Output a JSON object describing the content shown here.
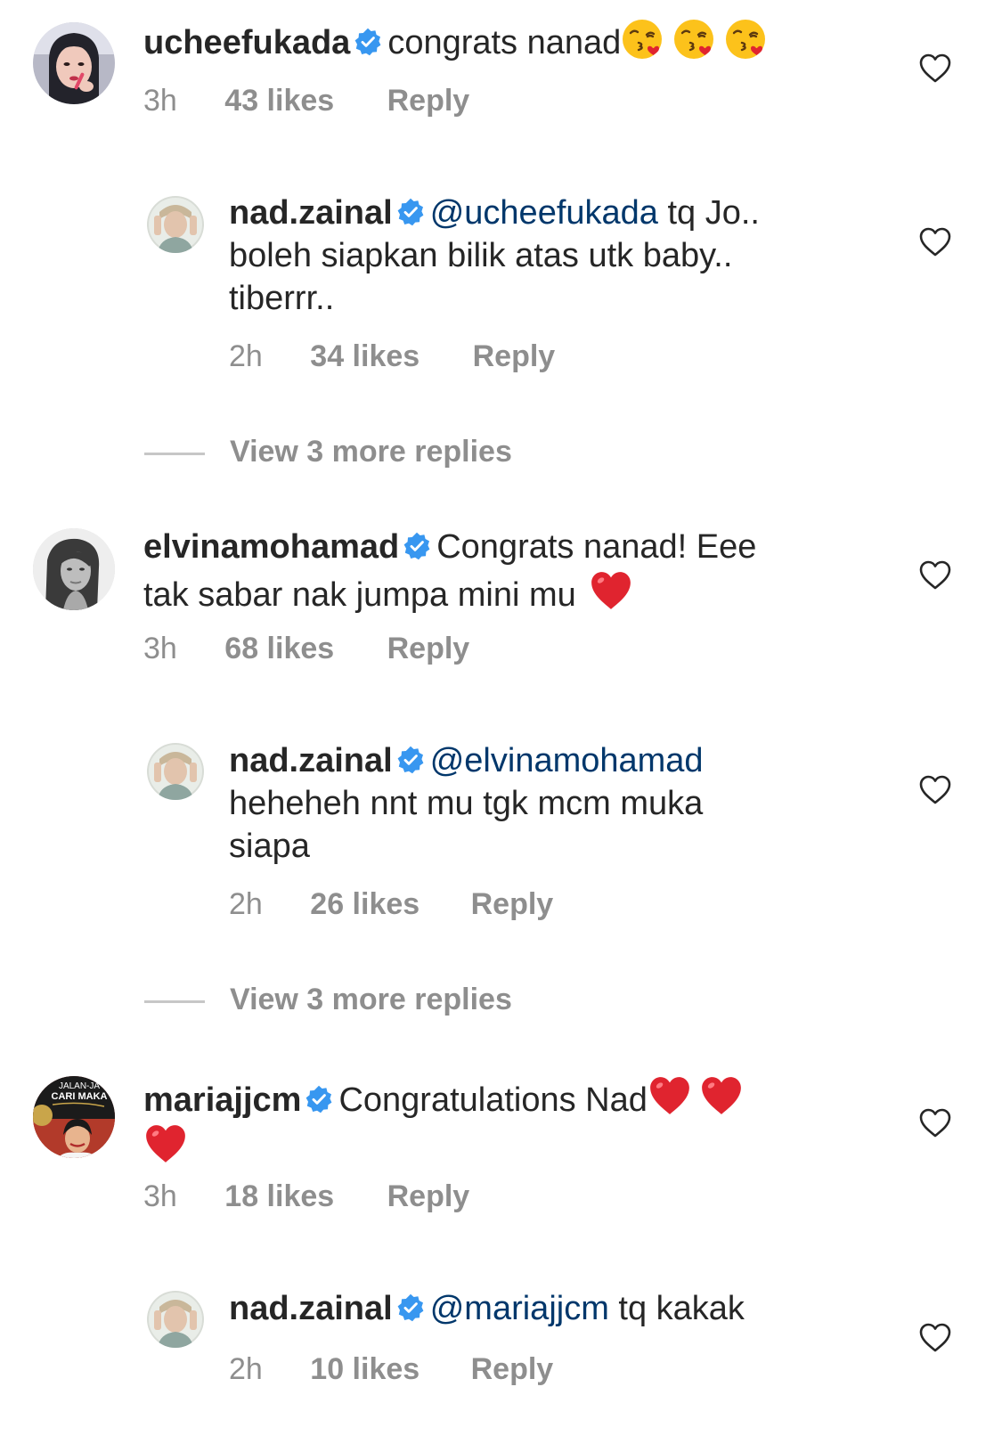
{
  "comments": [
    {
      "username": "ucheefukada",
      "text": "congrats nanad",
      "time": "3h",
      "likes": "43 likes",
      "reply_label": "Reply",
      "emojis": [
        "kiss-emoji",
        "kiss-emoji",
        "kiss-emoji"
      ],
      "reply": {
        "username": "nad.zainal",
        "mention": "@ucheefukada",
        "text_line1": " tq Jo..",
        "text_line2": "boleh siapkan bilik atas utk baby..",
        "text_line3": "tiberrr..",
        "time": "2h",
        "likes": "34 likes",
        "reply_label": "Reply"
      },
      "view_more": "View 3 more replies"
    },
    {
      "username": "elvinamohamad",
      "text_line1": "Congrats nanad! Eee",
      "text_line2": "tak sabar nak jumpa mini mu",
      "time": "3h",
      "likes": "68 likes",
      "reply_label": "Reply",
      "emojis": [
        "red-heart-emoji"
      ],
      "reply": {
        "username": "nad.zainal",
        "mention": "@elvinamohamad",
        "text_line2": "heheheh nnt mu tgk mcm muka",
        "text_line3": "siapa",
        "time": "2h",
        "likes": "26 likes",
        "reply_label": "Reply"
      },
      "view_more": "View 3 more replies"
    },
    {
      "username": "mariajjcm",
      "text": "Congratulations Nad",
      "time": "3h",
      "likes": "18 likes",
      "reply_label": "Reply",
      "emojis": [
        "red-heart-emoji",
        "red-heart-emoji",
        "red-heart-emoji"
      ],
      "avatar_text_1": "JALAN-JA",
      "avatar_text_2": "CARI MAKA",
      "reply": {
        "username": "nad.zainal",
        "mention": "@mariajjcm",
        "text_line1": " tq kakak",
        "time": "2h",
        "likes": "10 likes",
        "reply_label": "Reply"
      }
    }
  ],
  "colors": {
    "text": "#262626",
    "meta": "#8e8e8e",
    "mention": "#00376b",
    "verified": "#3897f0",
    "heart_emoji": "#e0242f"
  }
}
